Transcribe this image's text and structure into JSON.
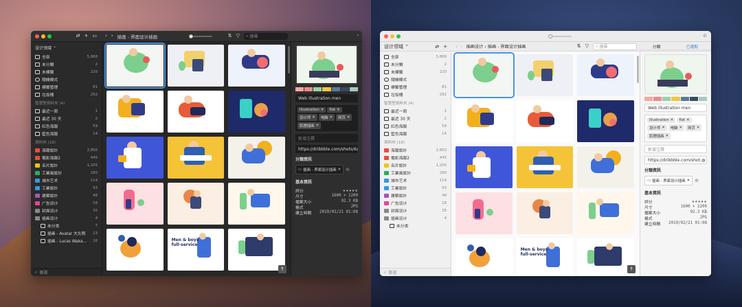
{
  "app": {
    "library_name": "设计领域",
    "breadcrumb_parent": "插画设计",
    "breadcrumb_current": "插画 - 界面设计插画",
    "breadcrumb_dark": "插画 - 界面设计插画",
    "search_placeholder": "搜尋",
    "sidebar_filter_placeholder": "篩選"
  },
  "sidebar": {
    "main_items": [
      {
        "label": "全部",
        "count": "5,868"
      },
      {
        "label": "未分類",
        "count": "2"
      },
      {
        "label": "未標籤",
        "count": "220"
      },
      {
        "label": "隨機模式",
        "count": ""
      },
      {
        "label": "標籤管理",
        "count": "81"
      },
      {
        "label": "垃圾桶",
        "count": "292"
      }
    ],
    "smart_header": "智慧型資料夾 (4)",
    "smart_items": [
      {
        "label": "最近一周",
        "count": "1"
      },
      {
        "label": "最近 30 天",
        "count": "2"
      },
      {
        "label": "紅色海報",
        "count": "59"
      },
      {
        "label": "藍色海報",
        "count": "14"
      }
    ],
    "folders_header": "資料夾 (18)",
    "folders": [
      {
        "label": "海報設計",
        "count": "2,850",
        "color": "#e74c3c"
      },
      {
        "label": "電影海報2",
        "count": "445",
        "color": "#e74c3c"
      },
      {
        "label": "名片設計",
        "count": "1,205",
        "color": "#f1c40f"
      },
      {
        "label": "工業風設計",
        "count": "290",
        "color": "#27ae60"
      },
      {
        "label": "城市艺术",
        "count": "114",
        "color": "#3498db"
      },
      {
        "label": "工業設計",
        "count": "93",
        "color": "#3498db"
      },
      {
        "label": "建築設計",
        "count": "48",
        "color": "#9b59b6"
      },
      {
        "label": "广告设计",
        "count": "18",
        "color": "#e84393"
      },
      {
        "label": "封面设计",
        "count": "35",
        "color": "#888888"
      },
      {
        "label": "插画设计",
        "count": "4",
        "color": "#888888"
      }
    ],
    "sub_folders": [
      {
        "label": "未分类",
        "count": "7"
      },
      {
        "label": "插画 - Avatar 大头照",
        "count": "23"
      },
      {
        "label": "插画 - Lucas Waka...",
        "count": "16"
      }
    ],
    "light_sub_folders": [
      {
        "label": "未分类",
        "count": ""
      }
    ]
  },
  "inspector": {
    "tabs": [
      "分類",
      "已選取"
    ],
    "name": "Web illustration men",
    "tags": [
      "Illustration",
      "flat",
      "设计师",
      "电脑",
      "网页",
      "肌理插画"
    ],
    "note_placeholder": "新增注釋",
    "url": "https://dribbble.com/shots/6",
    "url_light": "https://dribbble.com/shot:",
    "folder_header": "分類資訊",
    "folder_chip": "插画 - 界面设计插画",
    "basic_header": "基本資訊",
    "rows": [
      {
        "k": "評分",
        "v": "★★★★★"
      },
      {
        "k": "尺寸",
        "v": "1600 × 1200"
      },
      {
        "k": "檔案大小",
        "v": "92.3 KB"
      },
      {
        "k": "格式",
        "v": "JPG"
      },
      {
        "k": "建立時間",
        "v": "2019/02/21 01:08"
      }
    ],
    "swatch_colors": [
      "#f4a7a0",
      "#f08a8a",
      "#9bd0a8",
      "#f4c542",
      "#5a7a9a",
      "#3b4a5c",
      "#a8c7c2"
    ]
  },
  "thumbs_text": {
    "card_heading": "Men & boys full-service"
  },
  "colors": {
    "accent": "#4a90e2",
    "star": "#f2b01e",
    "traffic_red": "#ff5f57",
    "traffic_yellow": "#febc2e",
    "traffic_green": "#28c840"
  }
}
